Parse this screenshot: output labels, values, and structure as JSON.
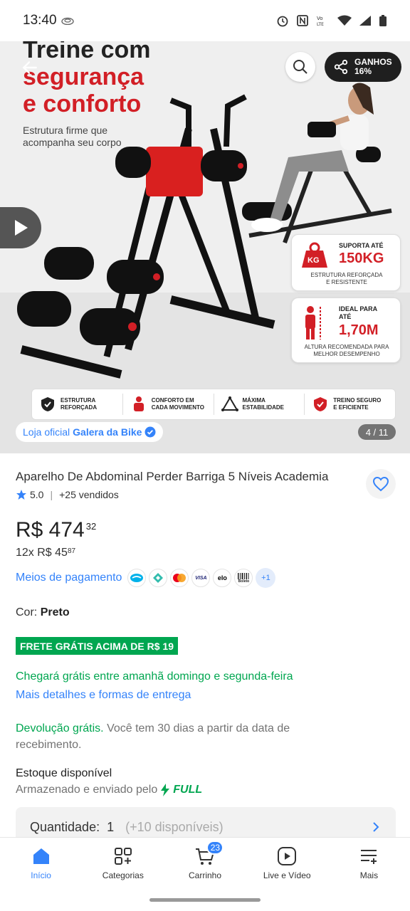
{
  "status": {
    "time": "13:40"
  },
  "gallery": {
    "promo_line1": "Treine com",
    "promo_line2": "segurança",
    "promo_line3": "e conforto",
    "promo_sub": "Estrutura firme que acompanha seu corpo",
    "share_label": "GANHOS",
    "share_percent": "16%",
    "spec1_title": "SUPORTA ATÉ",
    "spec1_value": "150KG",
    "spec1_foot": "ESTRUTURA REFORÇADA E RESISTENTE",
    "spec1_icon_text": "KG",
    "spec2_title": "IDEAL PARA ATÉ",
    "spec2_value": "1,70M",
    "spec2_foot": "ALTURA RECOMENDADA PARA MELHOR DESEMPENHO",
    "features": [
      "ESTRUTURA REFORÇADA",
      "CONFORTO EM CADA MOVIMENTO",
      "MÁXIMA ESTABILIDADE",
      "TREINO SEGURO E EFICIENTE"
    ],
    "store_prefix": "Loja oficial",
    "store_name": "Galera da Bike",
    "counter": "4 / 11"
  },
  "product": {
    "title": "Aparelho De Abdominal Perder Barriga 5 Níveis Academia",
    "rating": "5.0",
    "sold": "+25 vendidos",
    "price_main": "R$ 474",
    "price_cents": "32",
    "installment_main": "12x R$ 45",
    "installment_cents": "87",
    "payment_link": "Meios de pagamento",
    "payment_icons": [
      "mercado-pago",
      "pix",
      "mastercard",
      "VISA",
      "elo",
      "Boleto"
    ],
    "payment_more": "+1",
    "color_label": "Cor:",
    "color_value": "Preto",
    "free_shipping": "FRETE GRÁTIS ACIMA DE R$ 19",
    "arrival": "Chegará grátis entre amanhã domingo e segunda-feira",
    "more_details": "Mais detalhes e formas de entrega",
    "returns_bold": "Devolução grátis.",
    "returns_text": " Você tem 30 dias a partir da data de recebimento.",
    "stock_title": "Estoque disponível",
    "stock_sub": "Armazenado e enviado pelo",
    "full_label": "FULL",
    "quantity_label": "Quantidade:",
    "quantity_value": "1",
    "quantity_available": "(+10 disponíveis)"
  },
  "nav": {
    "items": [
      "Início",
      "Categorias",
      "Carrinho",
      "Live e Vídeo",
      "Mais"
    ],
    "cart_count": "23"
  },
  "colors": {
    "accent": "#3483fa",
    "green": "#00a650",
    "red": "#d21f26"
  }
}
